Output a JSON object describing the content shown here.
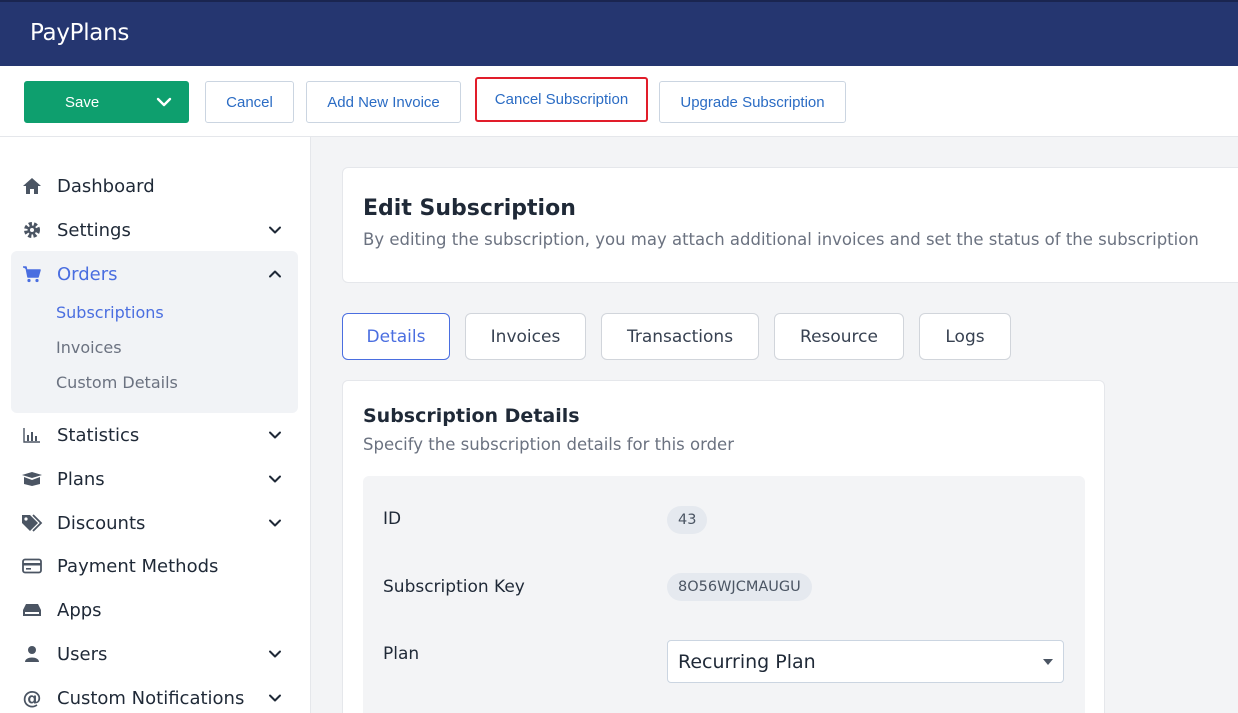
{
  "app": {
    "title": "PayPlans"
  },
  "toolbar": {
    "save": "Save",
    "cancel": "Cancel",
    "add_new_invoice": "Add New Invoice",
    "cancel_subscription": "Cancel Subscription",
    "upgrade_subscription": "Upgrade Subscription"
  },
  "sidebar": {
    "dashboard": "Dashboard",
    "settings": "Settings",
    "orders": "Orders",
    "orders_sub": [
      "Subscriptions",
      "Invoices",
      "Custom Details"
    ],
    "statistics": "Statistics",
    "plans": "Plans",
    "discounts": "Discounts",
    "payment_methods": "Payment Methods",
    "apps": "Apps",
    "users": "Users",
    "custom_notifications": "Custom Notifications"
  },
  "header": {
    "title": "Edit Subscription",
    "subtitle": "By editing the subscription, you may attach additional invoices and set the status of the subscription"
  },
  "tabs": [
    "Details",
    "Invoices",
    "Transactions",
    "Resource",
    "Logs"
  ],
  "details": {
    "title": "Subscription Details",
    "subtitle": "Specify the subscription details for this order",
    "id_label": "ID",
    "id_value": "43",
    "key_label": "Subscription Key",
    "key_value": "8O56WJCMAUGU",
    "plan_label": "Plan",
    "plan_value": "Recurring Plan"
  },
  "colors": {
    "topbar": "#253670",
    "save_button": "#0e9f6e",
    "accent": "#4a6ee0",
    "highlight_border": "#e11d2a"
  }
}
